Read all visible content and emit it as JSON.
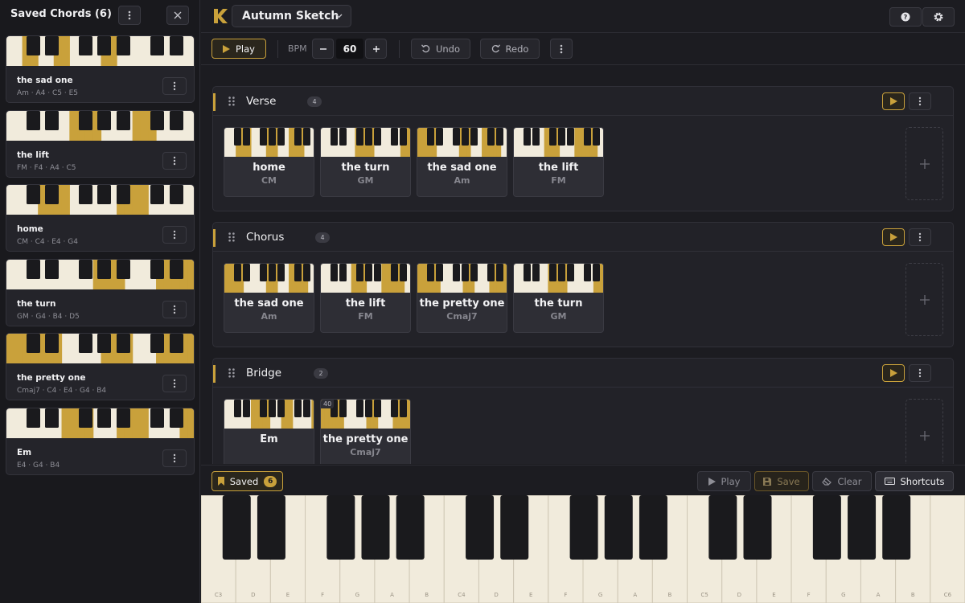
{
  "sidebar": {
    "title": "Saved Chords (6)",
    "cards": [
      {
        "name": "the sad one",
        "notes": "Am · A4 · C5 · E5",
        "keys": "0,0,1,1,0,0,1,1,0,0,0,0,1,1,0,0,0,0,0,0,0,0,0,0"
      },
      {
        "name": "the lift",
        "notes": "FM · F4 · A4 · C5",
        "keys": "0,0,0,0,0,0,0,0,1,1,1,1,0,0,0,0,1,1,1,0,0,0,0,0"
      },
      {
        "name": "home",
        "notes": "CM · C4 · E4 · G4",
        "keys": "0,0,0,0,1,1,1,1,0,0,0,0,0,0,1,1,1,1,0,0,0,0,0,0"
      },
      {
        "name": "the turn",
        "notes": "GM · G4 · B4 · D5",
        "keys": "0,0,0,0,0,0,0,0,0,0,0,1,1,1,1,0,0,0,0,1,1,1,1,1"
      },
      {
        "name": "the pretty one",
        "notes": "Cmaj7 · C4 · E4 · G4 · B4",
        "keys": "1,1,1,1,1,1,1,0,0,0,0,0,1,1,1,1,0,0,0,1,1,1,1,1"
      },
      {
        "name": "Em",
        "notes": "E4 · G4 · B4",
        "keys": "0,0,0,0,0,0,0,1,1,1,1,0,0,0,1,1,1,1,0,0,0,0,1,1"
      }
    ]
  },
  "header": {
    "project": "Autumn Sketch"
  },
  "toolbar": {
    "play": "Play",
    "bpm_label": "BPM",
    "bpm": "60",
    "undo": "Undo",
    "redo": "Redo"
  },
  "sections": [
    {
      "title": "Verse",
      "count": "4",
      "chords": [
        {
          "name": "home",
          "symbol": "CM",
          "keys": "0,0,0,1,1,1,1,0,0,0,0,1,1,1,0,0,0,1,1,1,1,0,0,0"
        },
        {
          "name": "the turn",
          "symbol": "GM",
          "keys": "0,0,0,0,0,0,0,0,0,1,1,1,1,1,0,0,0,0,0,0,0,1,1,1"
        },
        {
          "name": "the sad one",
          "symbol": "Am",
          "keys": "1,1,1,1,1,0,0,0,0,0,0,1,1,1,0,0,0,1,1,1,1,1,0,0"
        },
        {
          "name": "the lift",
          "symbol": "FM",
          "keys": "0,0,0,0,0,0,0,0,1,1,1,1,0,0,0,0,1,1,1,1,1,1,0,0"
        }
      ]
    },
    {
      "title": "Chorus",
      "count": "4",
      "chords": [
        {
          "name": "the sad one",
          "symbol": "Am",
          "keys": "1,1,1,1,1,0,0,0,0,0,0,1,1,1,0,0,0,1,1,1,1,1,0,0"
        },
        {
          "name": "the lift",
          "symbol": "FM",
          "keys": "0,0,0,0,0,0,0,0,1,1,1,1,0,0,0,0,1,1,1,1,1,1,0,0"
        },
        {
          "name": "the pretty one",
          "symbol": "Cmaj7",
          "keys": "1,1,1,1,1,1,0,0,0,0,0,0,1,1,1,0,0,0,0,1,1,1,1,1"
        },
        {
          "name": "the turn",
          "symbol": "GM",
          "keys": "0,0,0,0,0,0,0,0,0,1,1,1,1,1,0,0,0,0,0,0,0,1,1,1"
        }
      ]
    },
    {
      "title": "Bridge",
      "count": "2",
      "chords": [
        {
          "name": "Em",
          "symbol": "",
          "keys": "0,0,0,0,0,0,0,1,1,1,1,1,0,0,0,1,1,1,0,0,0,0,0,1"
        },
        {
          "name": "the pretty one",
          "symbol": "Cmaj7",
          "badge": "40",
          "keys": "1,1,1,1,1,1,0,0,0,0,0,0,1,1,1,0,0,0,0,1,1,1,1,1"
        }
      ]
    }
  ],
  "bottombar": {
    "saved": "Saved",
    "saved_count": "6",
    "play": "Play",
    "save": "Save",
    "clear": "Clear",
    "shortcuts": "Shortcuts"
  },
  "piano": {
    "white_labels": [
      "C3",
      "D",
      "E",
      "F",
      "G",
      "A",
      "B",
      "C4",
      "D",
      "E",
      "F",
      "G",
      "A",
      "B",
      "C5",
      "D",
      "E",
      "F",
      "G",
      "A",
      "B",
      "C6"
    ]
  },
  "colors": {
    "accent": "#c9a13b",
    "key_white": "#f1ebdc",
    "key_black": "#1a1a1d"
  }
}
